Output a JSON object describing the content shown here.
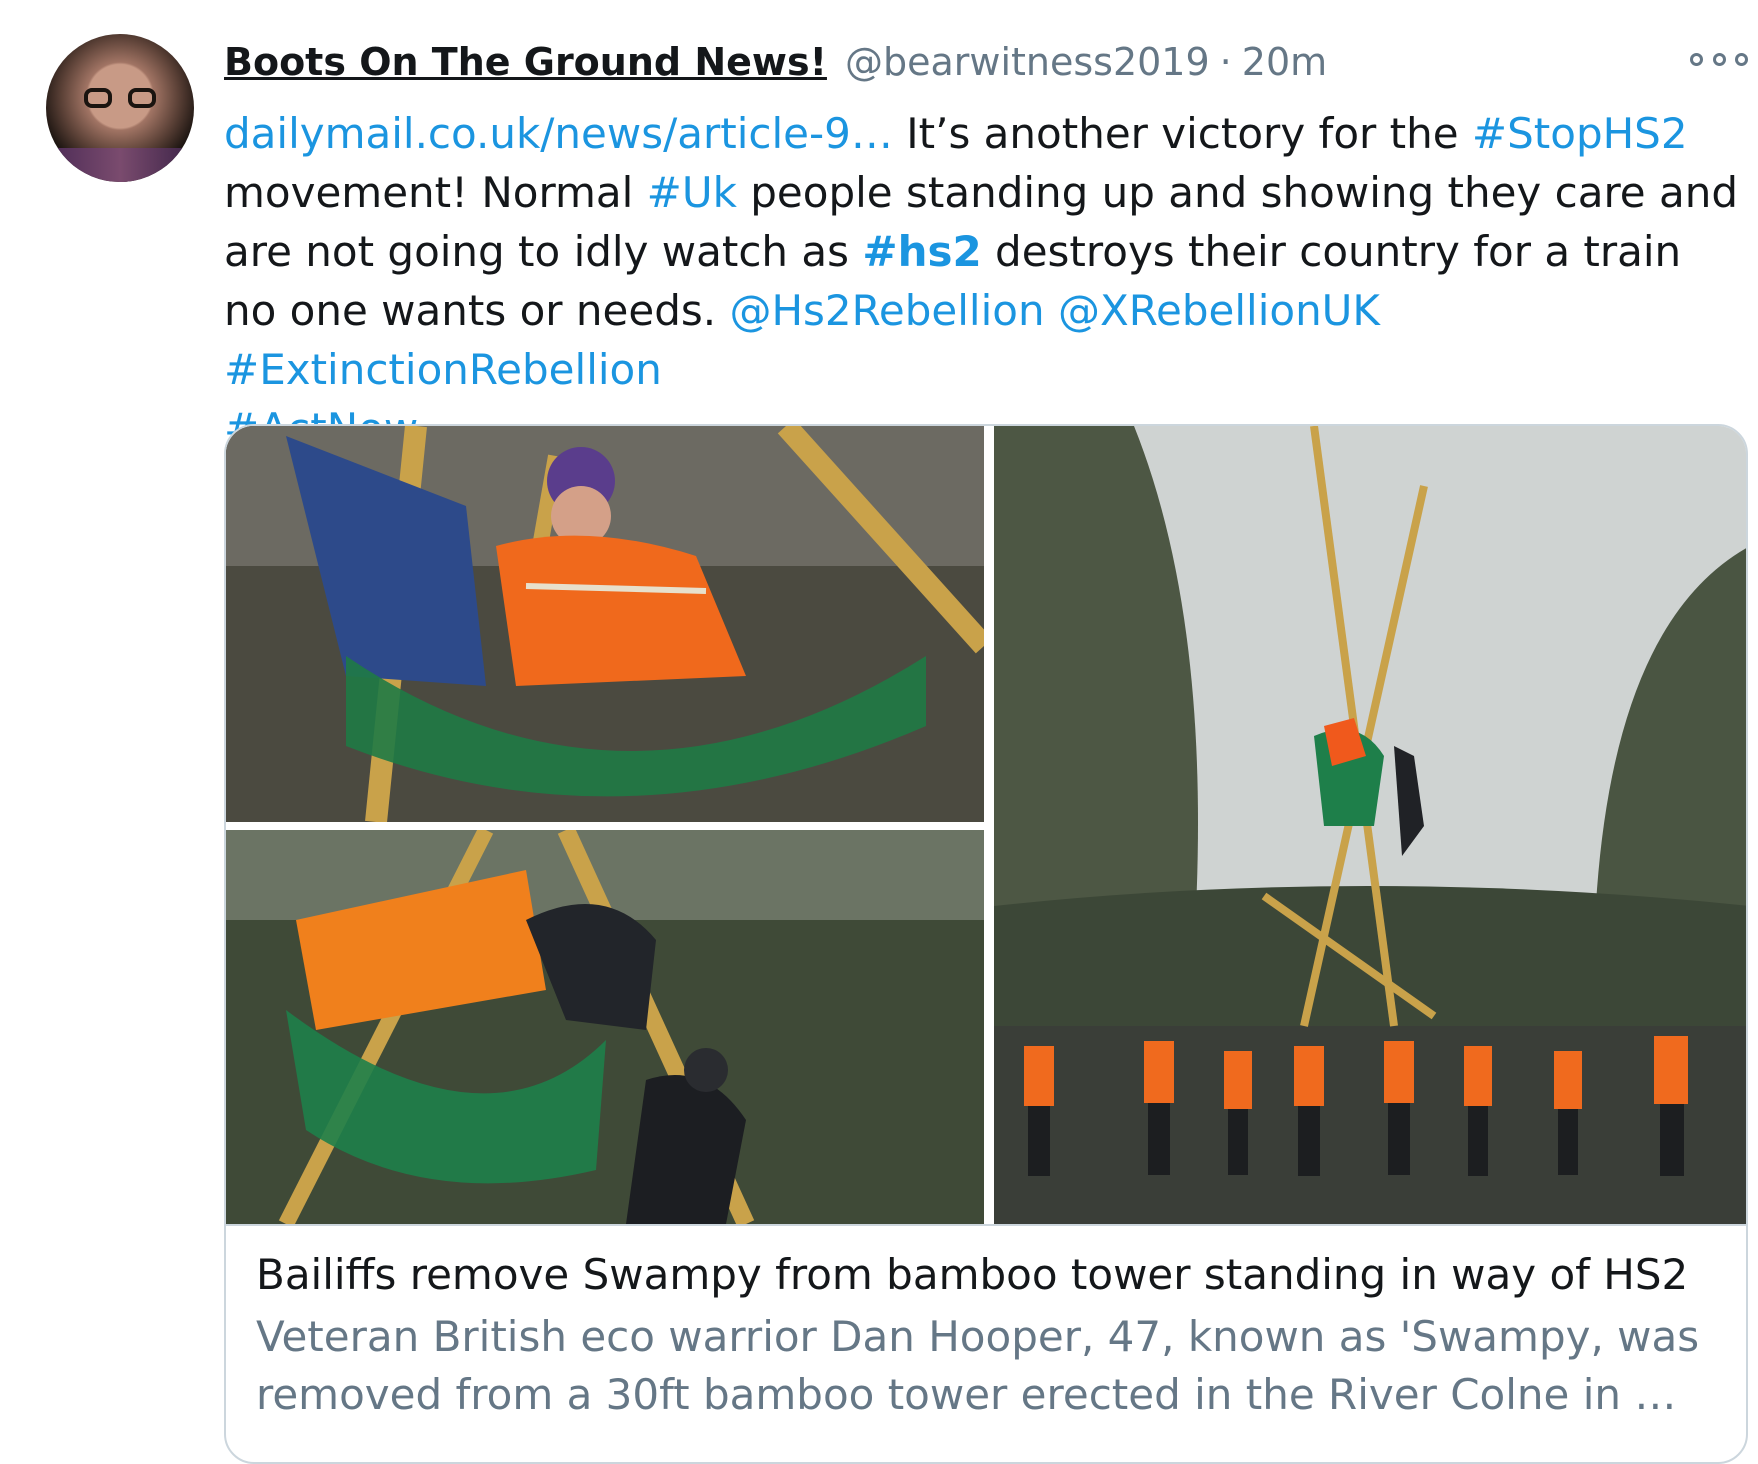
{
  "tweet": {
    "author_name": "Boots On The Ground News!",
    "handle": "@bearwitness2019",
    "separator": "·",
    "time": "20m",
    "text_parts": {
      "link": "dailymail.co.uk/news/article-9…",
      "t1": " It’s another victory for the ",
      "tag_stophs2": "#StopHS2",
      "t2": " movement! Normal ",
      "tag_uk": "#Uk",
      "t3": " people standing up and showing they care and are not going to idly watch as ",
      "tag_hs2": "#hs2",
      "t4": " destroys their country for a train no one wants or needs. ",
      "mention_hs2rebellion": "@Hs2Rebellion",
      "mention_xrebellionuk": "@XRebellionUK",
      "tag_extinction": "#ExtinctionRebellion",
      "tag_actnow": "#ActNow"
    },
    "card": {
      "title": "Bailiffs remove Swampy from bamboo tower standing in way of HS2",
      "description": "Veteran British eco warrior Dan Hooper, 47, known as 'Swampy, was removed from a 30ft bamboo tower erected in the River Colne in …"
    }
  },
  "colors": {
    "link": "#1b95e0",
    "secondary_text": "#657786",
    "border": "#ccd6dd"
  },
  "icons": {
    "more": "more-options-icon"
  }
}
